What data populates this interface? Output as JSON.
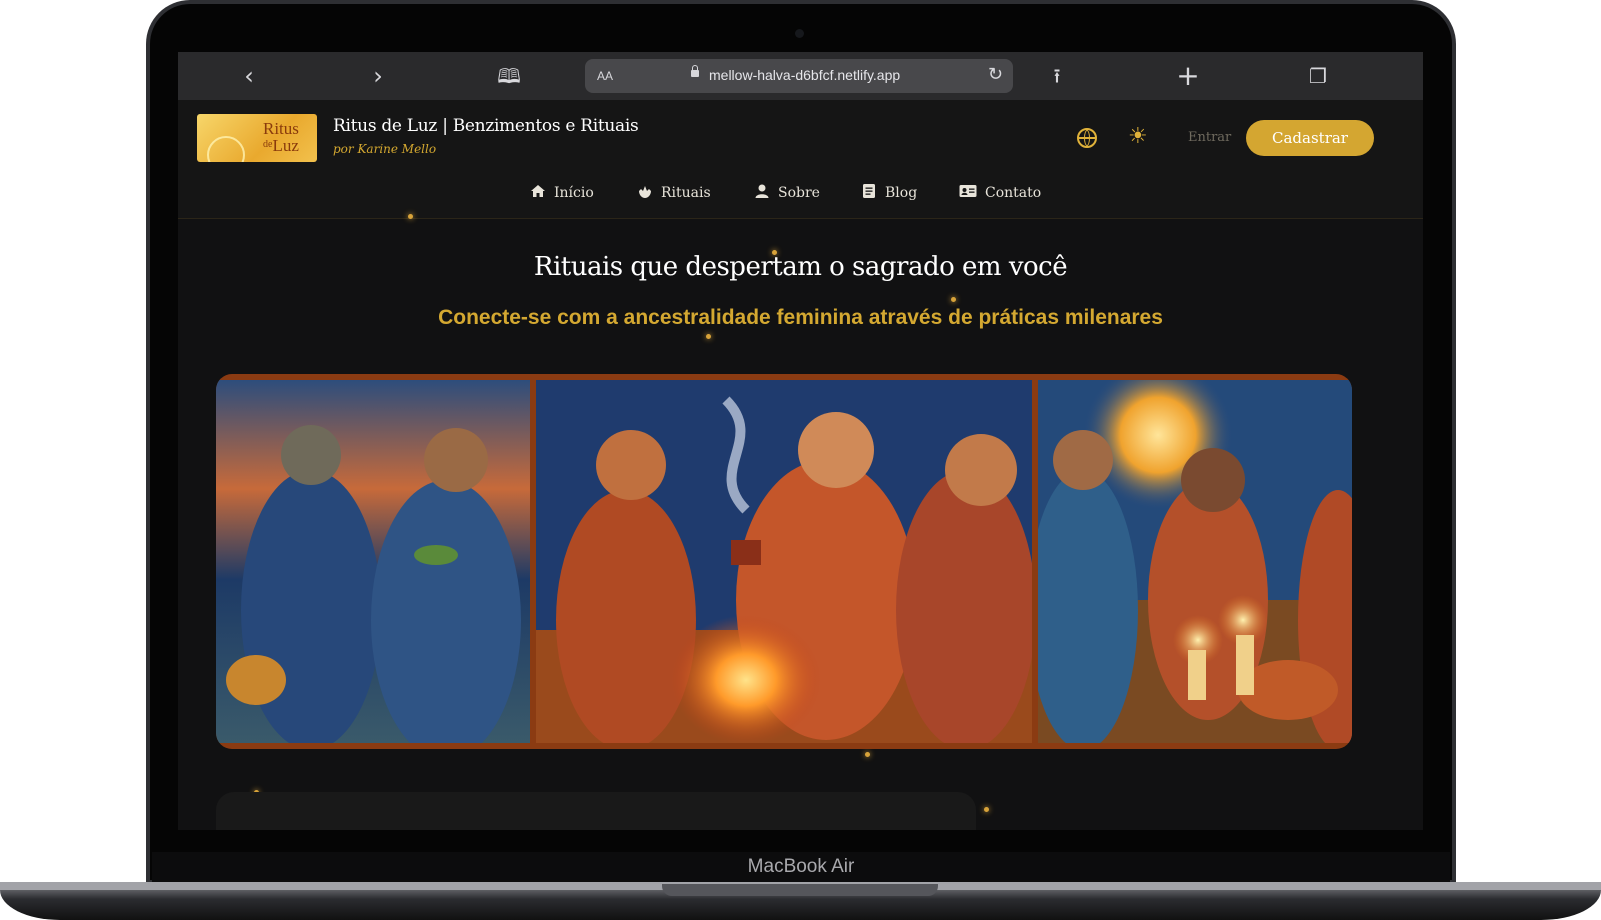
{
  "device": {
    "label": "MacBook Air"
  },
  "browser": {
    "url": "mellow-halva-d6bfcf.netlify.app",
    "text_size_label": "AA",
    "icons": [
      "back-icon",
      "forward-icon",
      "bookmarks-icon",
      "lock-icon",
      "reload-icon",
      "share-icon",
      "new-tab-icon",
      "tabs-icon"
    ]
  },
  "site": {
    "logo": {
      "line1": "Ritus",
      "line2_small": "de",
      "line2": "Luz"
    },
    "title": "Ritus de Luz | Benzimentos e Rituais",
    "subtitle": "por Karine Mello",
    "entrar": "Entrar",
    "cadastrar": "Cadastrar",
    "nav": [
      {
        "label": "Início",
        "icon": "home-icon"
      },
      {
        "label": "Rituais",
        "icon": "hand-icon"
      },
      {
        "label": "Sobre",
        "icon": "person-icon"
      },
      {
        "label": "Blog",
        "icon": "document-icon"
      },
      {
        "label": "Contato",
        "icon": "contact-card-icon"
      }
    ],
    "colors": {
      "accent": "#d4a631",
      "background": "#111112",
      "frame": "#8b3b12"
    }
  },
  "hero": {
    "title": "Rituais que despertam o sagrado em você",
    "subtitle": "Conecte-se com a ancestralidade feminina através de práticas milenares"
  }
}
